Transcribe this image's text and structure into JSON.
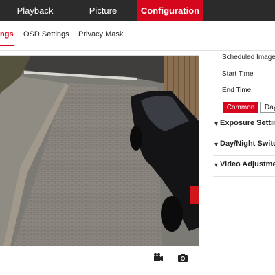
{
  "nav": {
    "items": [
      {
        "label": "Playback"
      },
      {
        "label": "Picture"
      },
      {
        "label": "Configuration"
      }
    ],
    "active_color": "#d6061d"
  },
  "subtabs": [
    {
      "label": "ngs"
    },
    {
      "label": "OSD Settings"
    },
    {
      "label": "Privacy Mask"
    }
  ],
  "video": {
    "toolbar_icons": [
      "record-icon",
      "snapshot-icon"
    ]
  },
  "panel": {
    "scheduled_label": "Scheduled Image",
    "start_time_label": "Start Time",
    "end_time_label": "End Time",
    "common_button": "Common",
    "day_button": "Day",
    "sections": [
      {
        "title": "Exposure Settings"
      },
      {
        "title": "Day/Night Switch"
      },
      {
        "title": "Video Adjustment"
      }
    ]
  }
}
